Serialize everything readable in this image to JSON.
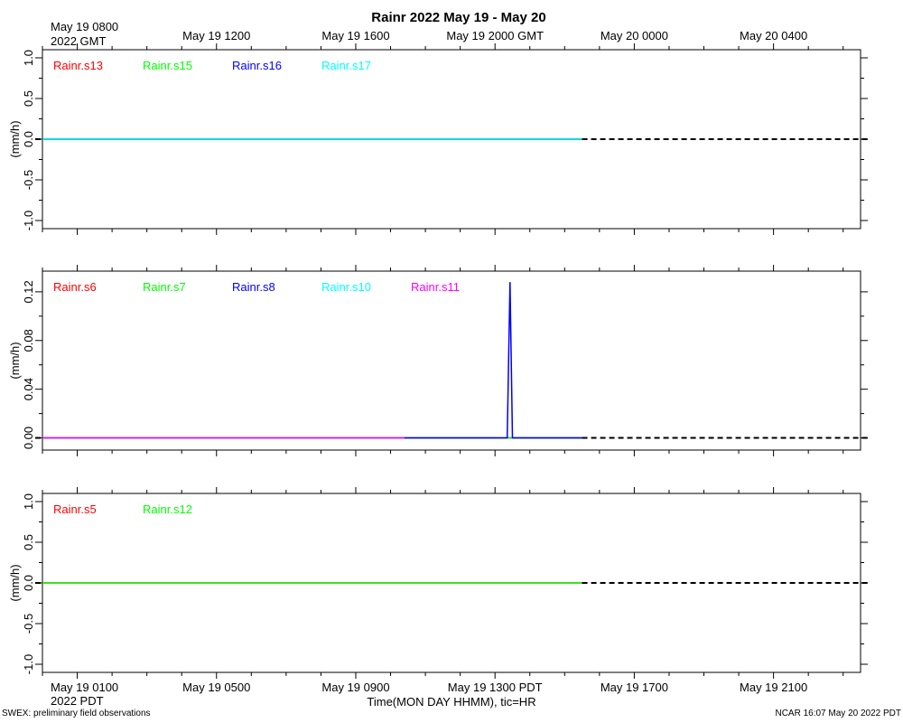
{
  "chart_data": {
    "type": "line",
    "title": "Rainr 2022 May 19 - May 20",
    "top_axis": {
      "first_label_line1": "May 19 0800",
      "first_label_line2": "2022 GMT",
      "tick_labels": [
        "May 19 1200",
        "May 19 1600",
        "May 19 2000 GMT",
        "May 20 0000",
        "May 20 0400"
      ]
    },
    "bottom_axis": {
      "first_label_line1": "May 19 0100",
      "first_label_line2": "2022 PDT",
      "tick_labels": [
        "May 19 0500",
        "May 19 0900",
        "May 19 1300 PDT",
        "May 19 1700",
        "May 19 2100"
      ],
      "xlabel": "Time(MON DAY HHMM), tic=HR"
    },
    "x_range_hours_pdt": [
      0,
      23.5
    ],
    "data_end_hours_pdt": 15.5,
    "panels": [
      {
        "ylabel": "(mm/h)",
        "ylim": [
          -1.1,
          1.1
        ],
        "yticks": [
          "-1.0",
          "-0.5",
          "0.0",
          "0.5",
          "1.0"
        ],
        "ytick_values": [
          -1.0,
          -0.5,
          0.0,
          0.5,
          1.0
        ],
        "reference_line": 0.0,
        "series": [
          {
            "name": "Rainr.s13",
            "color": "#ff0000",
            "points": [
              [
                0,
                0
              ],
              [
                15.5,
                0
              ]
            ]
          },
          {
            "name": "Rainr.s15",
            "color": "#00ff00",
            "points": [
              [
                0,
                0
              ],
              [
                15.5,
                0
              ]
            ]
          },
          {
            "name": "Rainr.s16",
            "color": "#0000ff",
            "points": [
              [
                0,
                0
              ],
              [
                15.5,
                0
              ]
            ]
          },
          {
            "name": "Rainr.s17",
            "color": "#00ffff",
            "points": [
              [
                0,
                0
              ],
              [
                15.5,
                0
              ]
            ]
          }
        ]
      },
      {
        "ylabel": "(mm/h)",
        "ylim": [
          -0.01,
          0.137
        ],
        "yticks": [
          "0.00",
          "0.04",
          "0.08",
          "0.12"
        ],
        "ytick_values": [
          0.0,
          0.04,
          0.08,
          0.12
        ],
        "reference_line": 0.0,
        "series": [
          {
            "name": "Rainr.s6",
            "color": "#ff0000",
            "points": [
              [
                0,
                0
              ],
              [
                15.5,
                0
              ]
            ]
          },
          {
            "name": "Rainr.s7",
            "color": "#00ff00",
            "points": [
              [
                0,
                0
              ],
              [
                15.5,
                0
              ]
            ]
          },
          {
            "name": "Rainr.s8",
            "color": "#0000ff",
            "points": [
              [
                0,
                0
              ],
              [
                13.35,
                0
              ],
              [
                13.43,
                0.128
              ],
              [
                13.5,
                0
              ],
              [
                15.5,
                0
              ]
            ]
          },
          {
            "name": "Rainr.s10",
            "color": "#00ffff",
            "points": [
              [
                0,
                0
              ],
              [
                10.4,
                0
              ]
            ]
          },
          {
            "name": "Rainr.s11",
            "color": "#ff00ff",
            "points": [
              [
                0,
                0
              ],
              [
                10.4,
                0
              ]
            ]
          }
        ]
      },
      {
        "ylabel": "(mm/h)",
        "ylim": [
          -1.1,
          1.1
        ],
        "yticks": [
          "-1.0",
          "-0.5",
          "0.0",
          "0.5",
          "1.0"
        ],
        "ytick_values": [
          -1.0,
          -0.5,
          0.0,
          0.5,
          1.0
        ],
        "reference_line": 0.0,
        "series": [
          {
            "name": "Rainr.s5",
            "color": "#ff0000",
            "points": [
              [
                0,
                0
              ],
              [
                15.5,
                0
              ]
            ]
          },
          {
            "name": "Rainr.s12",
            "color": "#00ff00",
            "points": [
              [
                0,
                0
              ],
              [
                15.5,
                0
              ]
            ]
          }
        ]
      }
    ],
    "footer_left": "SWEX: preliminary field observations",
    "footer_right": "NCAR 16:07 May 20 2022 PDT"
  }
}
